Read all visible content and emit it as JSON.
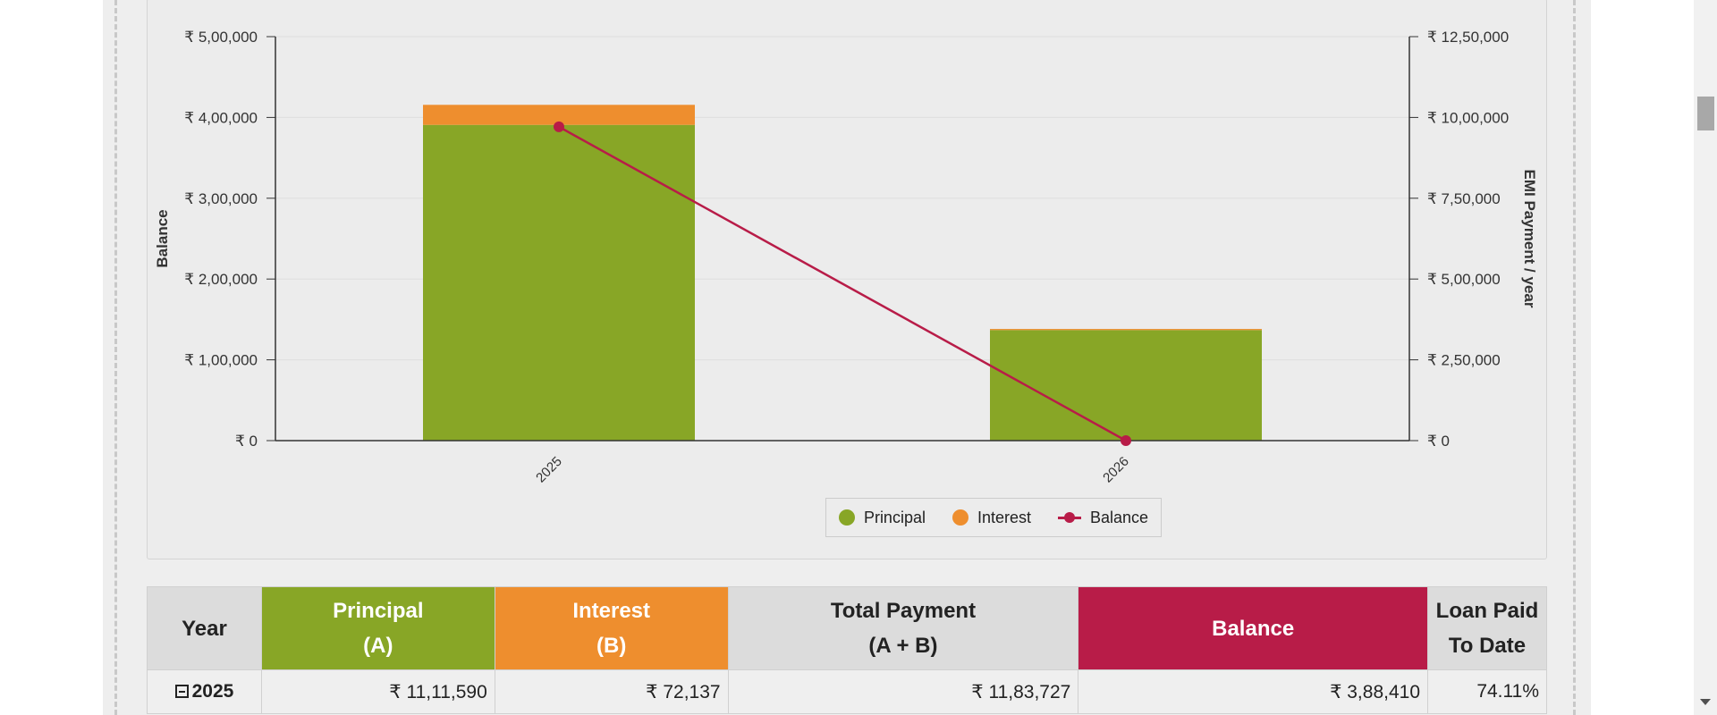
{
  "chart_data": {
    "type": "bar",
    "stacked": true,
    "categories": [
      "2025",
      "2026"
    ],
    "series": [
      {
        "name": "Principal",
        "type": "bar",
        "axis": "right",
        "color": "#88a626",
        "values": [
          977000,
          342000
        ]
      },
      {
        "name": "Interest",
        "type": "bar",
        "axis": "right",
        "color": "#ee8e2e",
        "values": [
          62000,
          3500
        ]
      },
      {
        "name": "Balance",
        "type": "line",
        "axis": "left",
        "color": "#b81c48",
        "values": [
          388410,
          0
        ]
      }
    ],
    "left_axis": {
      "title": "Balance",
      "ylim": [
        0,
        500000
      ],
      "ticks": [
        "₹ 0",
        "₹ 1,00,000",
        "₹ 2,00,000",
        "₹ 3,00,000",
        "₹ 4,00,000",
        "₹ 5,00,000"
      ]
    },
    "right_axis": {
      "title": "EMI Payment / year",
      "ylim": [
        0,
        1250000
      ],
      "ticks": [
        "₹ 0",
        "₹ 2,50,000",
        "₹ 5,00,000",
        "₹ 7,50,000",
        "₹ 10,00,000",
        "₹ 12,50,000"
      ]
    },
    "grid": true,
    "legend_position": "bottom-center"
  },
  "legend": {
    "principal": "Principal",
    "interest": "Interest",
    "balance": "Balance"
  },
  "colors": {
    "principal": "#88a626",
    "interest": "#ee8e2e",
    "balance": "#b81c48"
  },
  "table": {
    "headers": {
      "year": "Year",
      "principal_1": "Principal",
      "principal_2": "(A)",
      "interest_1": "Interest",
      "interest_2": "(B)",
      "total_1": "Total Payment",
      "total_2": "(A + B)",
      "balance_1": "Balance",
      "paid_1": "Loan Paid",
      "paid_2": "To Date"
    },
    "rows": [
      {
        "year": "2025",
        "principal": "₹ 11,11,590",
        "interest": "₹ 72,137",
        "total": "₹ 11,83,727",
        "balance": "₹ 3,88,410",
        "paid": "74.11%"
      }
    ]
  }
}
